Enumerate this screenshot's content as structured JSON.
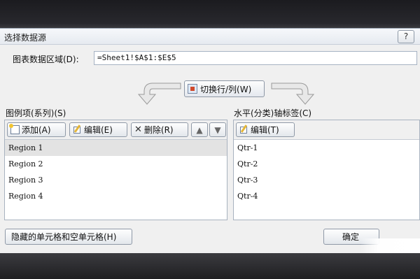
{
  "dialog": {
    "title": "选择数据源",
    "help_label": "?"
  },
  "range": {
    "label": "图表数据区域(D):",
    "value": "=Sheet1!$A$1:$E$5"
  },
  "switch_button": {
    "label": "切换行/列(W)"
  },
  "series_panel": {
    "label": "图例项(系列)(S)",
    "add_label": "添加(A)",
    "edit_label": "编辑(E)",
    "delete_label": "删除(R)",
    "up_label": "▲",
    "down_label": "▼",
    "items": [
      "Region 1",
      "Region 2",
      "Region 3",
      "Region 4"
    ],
    "selected_index": 0
  },
  "axis_panel": {
    "label": "水平(分类)轴标签(C)",
    "edit_label": "编辑(T)",
    "items": [
      "Qtr-1",
      "Qtr-2",
      "Qtr-3",
      "Qtr-4"
    ]
  },
  "footer": {
    "hidden_cells_label": "隐藏的单元格和空单元格(H)",
    "ok_label": "确定"
  },
  "icons": {
    "help": "help-icon",
    "switch": "switch-rows-columns-icon",
    "add": "add-series-icon",
    "edit": "pencil-icon",
    "delete": "delete-x-icon",
    "arrow_left": "curved-arrow-left-icon",
    "arrow_right": "curved-arrow-right-icon"
  }
}
